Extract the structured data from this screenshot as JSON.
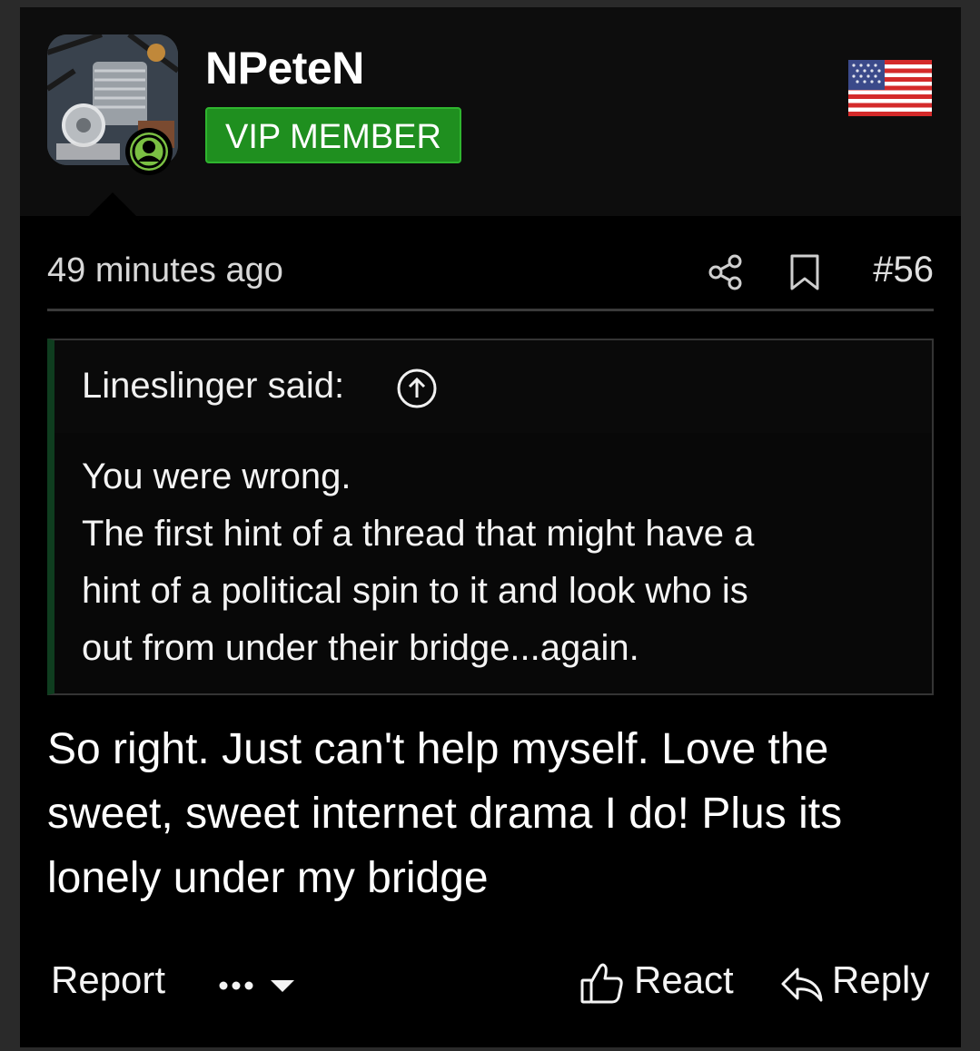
{
  "post": {
    "username": "NPeteN",
    "badge": "VIP MEMBER",
    "timestamp": "49 minutes ago",
    "post_number": "#56",
    "flag_icon": "us-flag-icon",
    "online_status_icon": "online-user-icon"
  },
  "quote": {
    "author": "Lineslinger said:",
    "lines": [
      "You were wrong.",
      "The first hint of a thread that might have a",
      "hint of a political spin to it and look who is",
      "out from under their bridge...again."
    ]
  },
  "message": {
    "lines": [
      "So right. Just can't help myself. Love the",
      "sweet, sweet internet drama I do! Plus its",
      "lonely under my bridge"
    ]
  },
  "actions": {
    "report": "Report",
    "react": "React",
    "reply": "Reply"
  },
  "colors": {
    "background": "#000000",
    "header_bg": "#0d0d0d",
    "badge_green": "#1f8f1f",
    "online_green": "#7bc043",
    "quote_accent": "#0f3d1f"
  }
}
